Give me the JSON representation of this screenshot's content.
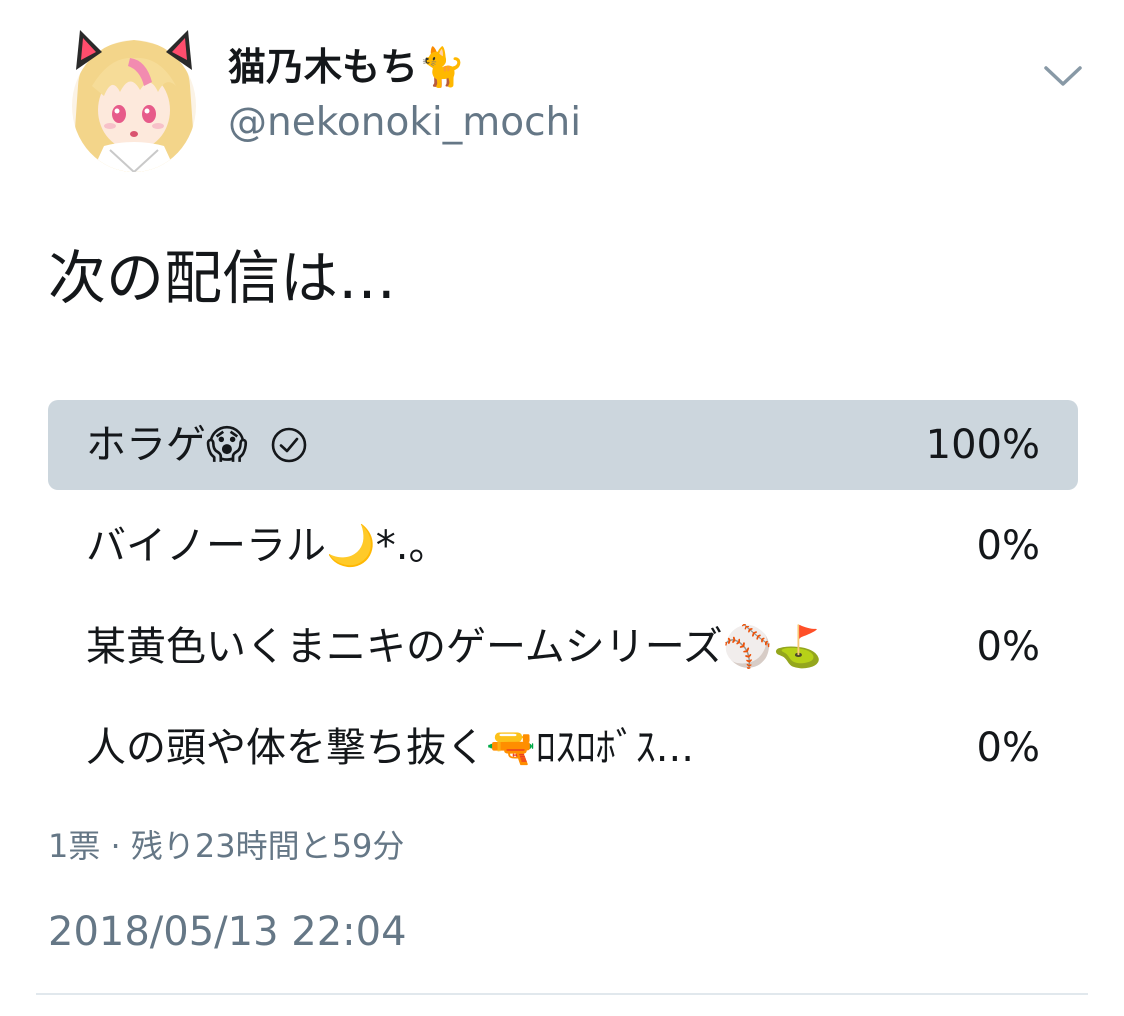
{
  "author": {
    "display_name": "猫乃木もち🐈",
    "handle": "@nekonoki_mochi"
  },
  "tweet": {
    "text": "次の配信は…"
  },
  "poll": {
    "options": [
      {
        "label": "ホラゲ😱",
        "percent": "100%",
        "fill_fraction": 1.0,
        "selected": true
      },
      {
        "label": "バイノーラル🌙*.。",
        "percent": "0%",
        "fill_fraction": 0.0,
        "selected": false
      },
      {
        "label": "某黄色いくまニキのゲームシリーズ⚾⛳",
        "percent": "0%",
        "fill_fraction": 0.0,
        "selected": false
      },
      {
        "label": "人の頭や体を撃ち抜く🔫ﾛｽﾛﾎﾞｽ...",
        "percent": "0%",
        "fill_fraction": 0.0,
        "selected": false
      }
    ],
    "meta": "1票 · 残り23時間と59分"
  },
  "timestamp": "2018/05/13 22:04",
  "icons": {
    "menu": "chevron-down-icon",
    "voted": "check-circle-icon"
  },
  "colors": {
    "poll_fill_winner": "#ccd6dd",
    "secondary_text": "#657786",
    "primary_text": "#14171a"
  }
}
